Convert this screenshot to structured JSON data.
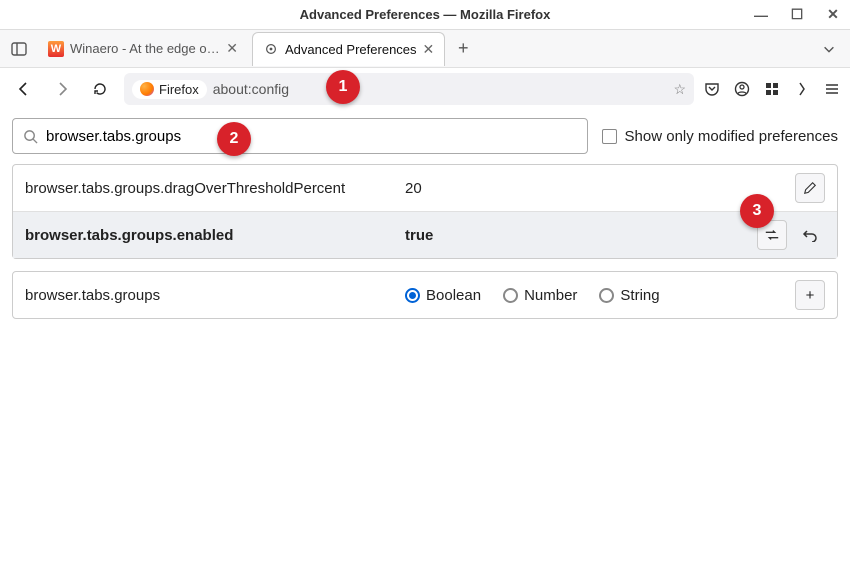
{
  "window": {
    "title": "Advanced Preferences — Mozilla Firefox"
  },
  "tabs": {
    "inactive": {
      "label": "Winaero - At the edge of tw"
    },
    "active": {
      "label": "Advanced Preferences"
    }
  },
  "address": {
    "badge": "Firefox",
    "url": "about:config"
  },
  "search": {
    "value": "browser.tabs.groups"
  },
  "modified_label": "Show only modified preferences",
  "prefs": [
    {
      "name": "browser.tabs.groups.dragOverThresholdPercent",
      "value": "20"
    },
    {
      "name": "browser.tabs.groups.enabled",
      "value": "true"
    }
  ],
  "newpref": {
    "name": "browser.tabs.groups",
    "types": {
      "boolean": "Boolean",
      "number": "Number",
      "string": "String"
    }
  },
  "markers": {
    "1": "1",
    "2": "2",
    "3": "3"
  }
}
